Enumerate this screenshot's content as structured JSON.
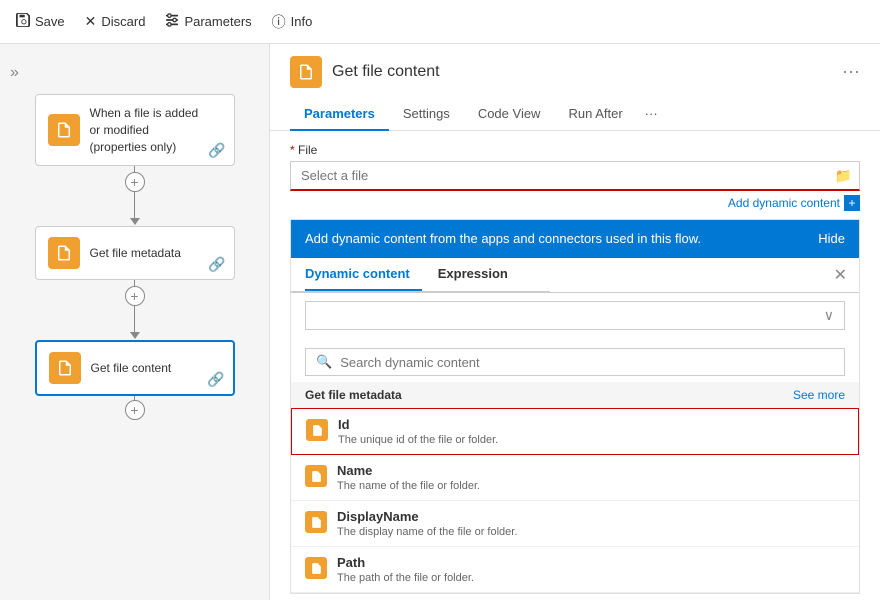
{
  "toolbar": {
    "save_label": "Save",
    "discard_label": "Discard",
    "parameters_label": "Parameters",
    "info_label": "Info"
  },
  "flow": {
    "nodes": [
      {
        "id": "trigger",
        "title": "When a file is added\nor modified\n(properties only)",
        "icon": "file-trigger-icon",
        "active": false
      },
      {
        "id": "get-metadata",
        "title": "Get file metadata",
        "icon": "file-metadata-icon",
        "active": false
      },
      {
        "id": "get-content",
        "title": "Get file content",
        "icon": "file-content-icon",
        "active": true
      }
    ]
  },
  "action": {
    "title": "Get file content",
    "icon": "file-content-icon",
    "tabs": [
      "Parameters",
      "Settings",
      "Code View",
      "Run After"
    ],
    "active_tab": "Parameters"
  },
  "parameters": {
    "file_label": "File",
    "file_required": true,
    "file_placeholder": "Select a file",
    "add_dynamic_label": "Add dynamic content"
  },
  "dynamic_content": {
    "info_text": "Add dynamic content from the apps and connectors used in this flow.",
    "hide_label": "Hide",
    "tabs": [
      "Dynamic content",
      "Expression"
    ],
    "active_tab": "Dynamic content",
    "search_placeholder": "Search dynamic content",
    "group_header": "Get file metadata",
    "see_more_label": "See more",
    "items": [
      {
        "id": "id-field",
        "name": "Id",
        "description": "The unique id of the file or folder.",
        "selected": true
      },
      {
        "id": "name-field",
        "name": "Name",
        "description": "The name of the file or folder.",
        "selected": false
      },
      {
        "id": "displayname-field",
        "name": "DisplayName",
        "description": "The display name of the file or folder.",
        "selected": false
      },
      {
        "id": "path-field",
        "name": "Path",
        "description": "The path of the file or folder.",
        "selected": false
      }
    ]
  }
}
